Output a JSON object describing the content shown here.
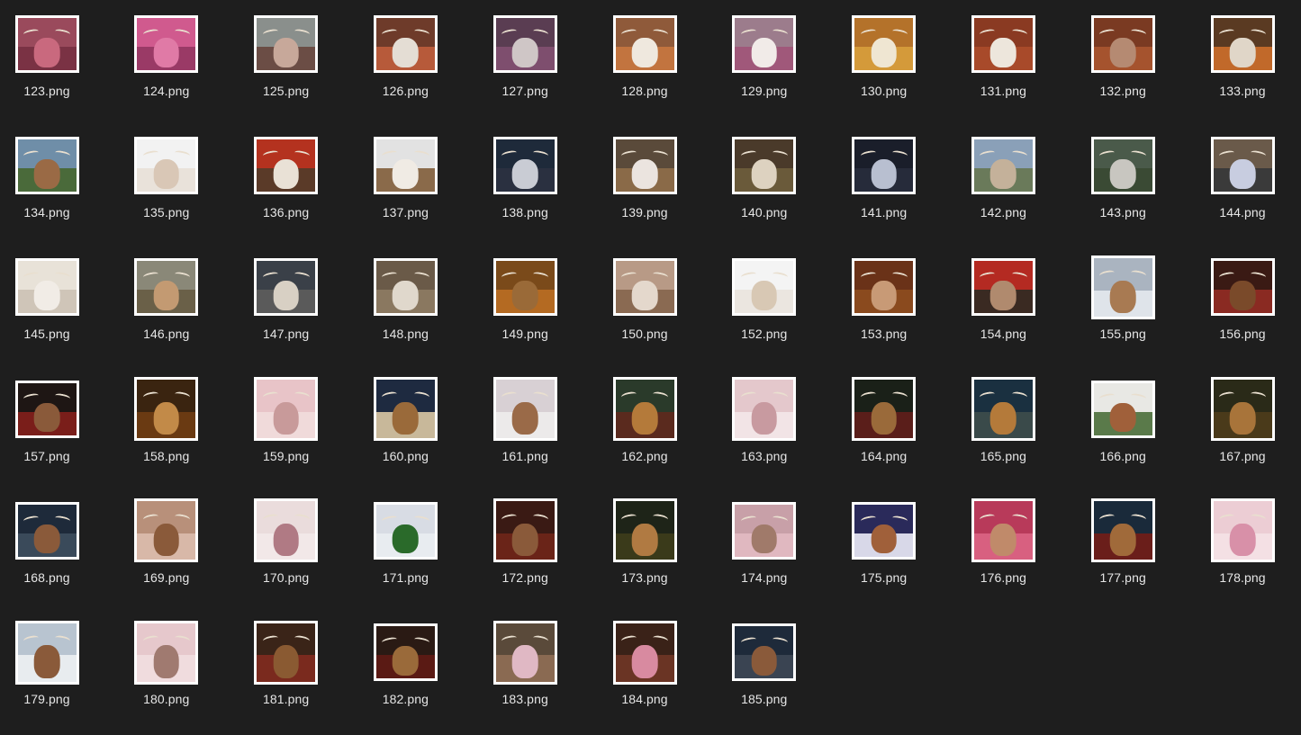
{
  "files": [
    {
      "name": "123.png",
      "bg": "#9a4a5c",
      "cow": "#c9697e",
      "ground": "#7a3244",
      "shape": "landscape"
    },
    {
      "name": "124.png",
      "bg": "#d05a8e",
      "cow": "#e07aa6",
      "ground": "#9a3a66",
      "shape": "landscape"
    },
    {
      "name": "125.png",
      "bg": "#8a8f8c",
      "cow": "#c7a89a",
      "ground": "#6b4d45",
      "shape": "landscape"
    },
    {
      "name": "126.png",
      "bg": "#6e3b2a",
      "cow": "#e4ddd4",
      "ground": "#b75a3a",
      "shape": "landscape"
    },
    {
      "name": "127.png",
      "bg": "#5a3d52",
      "cow": "#cfc6c6",
      "ground": "#7e4e6e",
      "shape": "landscape"
    },
    {
      "name": "128.png",
      "bg": "#8f5a3a",
      "cow": "#efe8de",
      "ground": "#c2743f",
      "shape": "landscape"
    },
    {
      "name": "129.png",
      "bg": "#9c7c8c",
      "cow": "#f1ebe8",
      "ground": "#a0587a",
      "shape": "landscape"
    },
    {
      "name": "130.png",
      "bg": "#b4722a",
      "cow": "#efe6d2",
      "ground": "#d49a3a",
      "shape": "landscape"
    },
    {
      "name": "131.png",
      "bg": "#8a3a22",
      "cow": "#ede6dc",
      "ground": "#a84a2a",
      "shape": "landscape"
    },
    {
      "name": "132.png",
      "bg": "#7a3a22",
      "cow": "#b58a72",
      "ground": "#a5532e",
      "shape": "landscape"
    },
    {
      "name": "133.png",
      "bg": "#5a3a22",
      "cow": "#e0d6c8",
      "ground": "#c1692a",
      "shape": "landscape"
    },
    {
      "name": "134.png",
      "bg": "#6f8ea8",
      "cow": "#9a6a45",
      "ground": "#4a6a3a",
      "shape": "landscape"
    },
    {
      "name": "135.png",
      "bg": "#f2f2f2",
      "cow": "#d9c7b6",
      "ground": "#e9e2da",
      "shape": "landscape"
    },
    {
      "name": "136.png",
      "bg": "#b4321f",
      "cow": "#e9e1d6",
      "ground": "#5a3a28",
      "shape": "landscape"
    },
    {
      "name": "137.png",
      "bg": "#e2e2e2",
      "cow": "#f0ebe4",
      "ground": "#8a6a4a",
      "shape": "landscape"
    },
    {
      "name": "138.png",
      "bg": "#1e2a3a",
      "cow": "#c9ccd4",
      "ground": "#2a3040",
      "shape": "landscape"
    },
    {
      "name": "139.png",
      "bg": "#5a4a3a",
      "cow": "#ebe4df",
      "ground": "#8a6a48",
      "shape": "landscape"
    },
    {
      "name": "140.png",
      "bg": "#4a3a2a",
      "cow": "#ddd2c0",
      "ground": "#6a5a3a",
      "shape": "landscape"
    },
    {
      "name": "141.png",
      "bg": "#1a1e2a",
      "cow": "#b8bfd0",
      "ground": "#262b3a",
      "shape": "landscape"
    },
    {
      "name": "142.png",
      "bg": "#8aa0b8",
      "cow": "#c4b19a",
      "ground": "#6a7a5a",
      "shape": "landscape"
    },
    {
      "name": "143.png",
      "bg": "#4a5a4a",
      "cow": "#c8c6c0",
      "ground": "#3a4a34",
      "shape": "landscape"
    },
    {
      "name": "144.png",
      "bg": "#6a5a4a",
      "cow": "#c8cde0",
      "ground": "#3a3a3a",
      "shape": "landscape"
    },
    {
      "name": "145.png",
      "bg": "#e8e2d8",
      "cow": "#f1ece6",
      "ground": "#cfc5b8",
      "shape": "landscape"
    },
    {
      "name": "146.png",
      "bg": "#8a8878",
      "cow": "#c39a72",
      "ground": "#6a6048",
      "shape": "landscape"
    },
    {
      "name": "147.png",
      "bg": "#3a4048",
      "cow": "#d8d0c4",
      "ground": "#5a5a5a",
      "shape": "landscape"
    },
    {
      "name": "148.png",
      "bg": "#6a5a48",
      "cow": "#e0d8cc",
      "ground": "#8a7860",
      "shape": "landscape"
    },
    {
      "name": "149.png",
      "bg": "#7a4a1a",
      "cow": "#9a6a38",
      "ground": "#b46a22",
      "shape": "landscape"
    },
    {
      "name": "150.png",
      "bg": "#b89a86",
      "cow": "#e4d8cc",
      "ground": "#8a6a52",
      "shape": "landscape"
    },
    {
      "name": "152.png",
      "bg": "#f4f4f4",
      "cow": "#d8c8b4",
      "ground": "#ebe6e0",
      "shape": "landscape"
    },
    {
      "name": "153.png",
      "bg": "#6a3218",
      "cow": "#c89a76",
      "ground": "#8a4a1e",
      "shape": "landscape"
    },
    {
      "name": "154.png",
      "bg": "#b42a22",
      "cow": "#b08a6e",
      "ground": "#3a2a22",
      "shape": "landscape"
    },
    {
      "name": "155.png",
      "bg": "#aab4c0",
      "cow": "#a87a52",
      "ground": "#dfe4ea",
      "shape": "square"
    },
    {
      "name": "156.png",
      "bg": "#3a1a14",
      "cow": "#7a4a2a",
      "ground": "#8a2a22",
      "shape": "landscape"
    },
    {
      "name": "157.png",
      "bg": "#1e1614",
      "cow": "#8a5a3a",
      "ground": "#7a1e1a",
      "shape": "landscape"
    },
    {
      "name": "158.png",
      "bg": "#3a2410",
      "cow": "#c28a48",
      "ground": "#6a3a12",
      "shape": "square"
    },
    {
      "name": "159.png",
      "bg": "#e8c4c8",
      "cow": "#c89a9a",
      "ground": "#f0dada",
      "shape": "square"
    },
    {
      "name": "160.png",
      "bg": "#1e2a40",
      "cow": "#9a6a3a",
      "ground": "#c8b89a",
      "shape": "square"
    },
    {
      "name": "161.png",
      "bg": "#d8d0d4",
      "cow": "#9a6a48",
      "ground": "#eceaea",
      "shape": "square"
    },
    {
      "name": "162.png",
      "bg": "#2a3a2a",
      "cow": "#b47a3a",
      "ground": "#5a2a1e",
      "shape": "square"
    },
    {
      "name": "163.png",
      "bg": "#e4c8cc",
      "cow": "#c89aa0",
      "ground": "#f2e4e6",
      "shape": "square"
    },
    {
      "name": "164.png",
      "bg": "#1a2018",
      "cow": "#9a6a3a",
      "ground": "#5a1e1a",
      "shape": "square"
    },
    {
      "name": "165.png",
      "bg": "#1a3040",
      "cow": "#b47a3a",
      "ground": "#3a4a4a",
      "shape": "square"
    },
    {
      "name": "166.png",
      "bg": "#e8e8e4",
      "cow": "#a0603a",
      "ground": "#5a7a4a",
      "shape": "landscape"
    },
    {
      "name": "167.png",
      "bg": "#2a2a18",
      "cow": "#a8743a",
      "ground": "#4a3a1a",
      "shape": "square"
    },
    {
      "name": "168.png",
      "bg": "#1e2a3a",
      "cow": "#8a5a3a",
      "ground": "#3a4a5a",
      "shape": "landscape"
    },
    {
      "name": "169.png",
      "bg": "#b8907a",
      "cow": "#8a5a3a",
      "ground": "#d8b8a8",
      "shape": "square"
    },
    {
      "name": "170.png",
      "bg": "#eadcdc",
      "cow": "#b07a84",
      "ground": "#f2e8e8",
      "shape": "square"
    },
    {
      "name": "171.png",
      "bg": "#d8dce4",
      "cow": "#2a6a2a",
      "ground": "#e8ecf0",
      "shape": "landscape"
    },
    {
      "name": "172.png",
      "bg": "#3a1a14",
      "cow": "#8a5a3a",
      "ground": "#6a2418",
      "shape": "square"
    },
    {
      "name": "173.png",
      "bg": "#1e2418",
      "cow": "#b07a42",
      "ground": "#3a3a1a",
      "shape": "square"
    },
    {
      "name": "174.png",
      "bg": "#c8a0a8",
      "cow": "#a07a6a",
      "ground": "#e0b8c0",
      "shape": "landscape"
    },
    {
      "name": "175.png",
      "bg": "#2a2a5a",
      "cow": "#a0603a",
      "ground": "#d8d8e8",
      "shape": "landscape"
    },
    {
      "name": "176.png",
      "bg": "#b83a5a",
      "cow": "#c08a6a",
      "ground": "#d86080",
      "shape": "square"
    },
    {
      "name": "177.png",
      "bg": "#1a2a3a",
      "cow": "#a06a3a",
      "ground": "#6a1e1a",
      "shape": "square"
    },
    {
      "name": "178.png",
      "bg": "#eccdd4",
      "cow": "#d890a8",
      "ground": "#f4e0e4",
      "shape": "square"
    },
    {
      "name": "179.png",
      "bg": "#b8c4d0",
      "cow": "#8a5a3a",
      "ground": "#e8ecef",
      "shape": "square"
    },
    {
      "name": "180.png",
      "bg": "#e6c8cc",
      "cow": "#a07a70",
      "ground": "#f0dcde",
      "shape": "square"
    },
    {
      "name": "181.png",
      "bg": "#3a2418",
      "cow": "#8a5a32",
      "ground": "#7a2a1e",
      "shape": "square"
    },
    {
      "name": "182.png",
      "bg": "#2a1a14",
      "cow": "#9a6a3a",
      "ground": "#5a1a14",
      "shape": "landscape"
    },
    {
      "name": "183.png",
      "bg": "#5a4a3a",
      "cow": "#e0b8c4",
      "ground": "#8a6a52",
      "shape": "square"
    },
    {
      "name": "184.png",
      "bg": "#3a2218",
      "cow": "#d88aa0",
      "ground": "#6a3424",
      "shape": "square"
    },
    {
      "name": "185.png",
      "bg": "#1e2a3a",
      "cow": "#8a5a3a",
      "ground": "#3a4452",
      "shape": "landscape"
    }
  ]
}
